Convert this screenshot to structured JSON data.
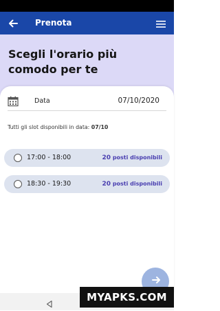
{
  "app_bar": {
    "title": "Prenota",
    "back_icon": "arrow-left-icon",
    "menu_icon": "hamburger-menu-icon"
  },
  "hero": {
    "title": "Scegli l'orario più comodo per te"
  },
  "date_field": {
    "icon": "calendar-icon",
    "label": "Data",
    "value": "07/10/2020"
  },
  "slots_info": {
    "prefix": "Tutti gli slot disponibili in data:",
    "date": "07/10"
  },
  "slots": [
    {
      "time": "17:00 - 18:00",
      "count": "20",
      "suffix": "posti disponibili"
    },
    {
      "time": "18:30 - 19:30",
      "count": "20",
      "suffix": "posti disponibili"
    }
  ],
  "fab": {
    "icon": "arrow-right-icon"
  },
  "nav_bar": {
    "back_icon": "triangle-back-icon"
  },
  "watermark": {
    "text": "MYAPKS.COM"
  },
  "colors": {
    "app_bar": "#1a47a8",
    "hero": "#dcd9f7",
    "slot_bg": "#dde3ef",
    "accent_text": "#4a3fb0",
    "fab": "#9db4e0"
  }
}
